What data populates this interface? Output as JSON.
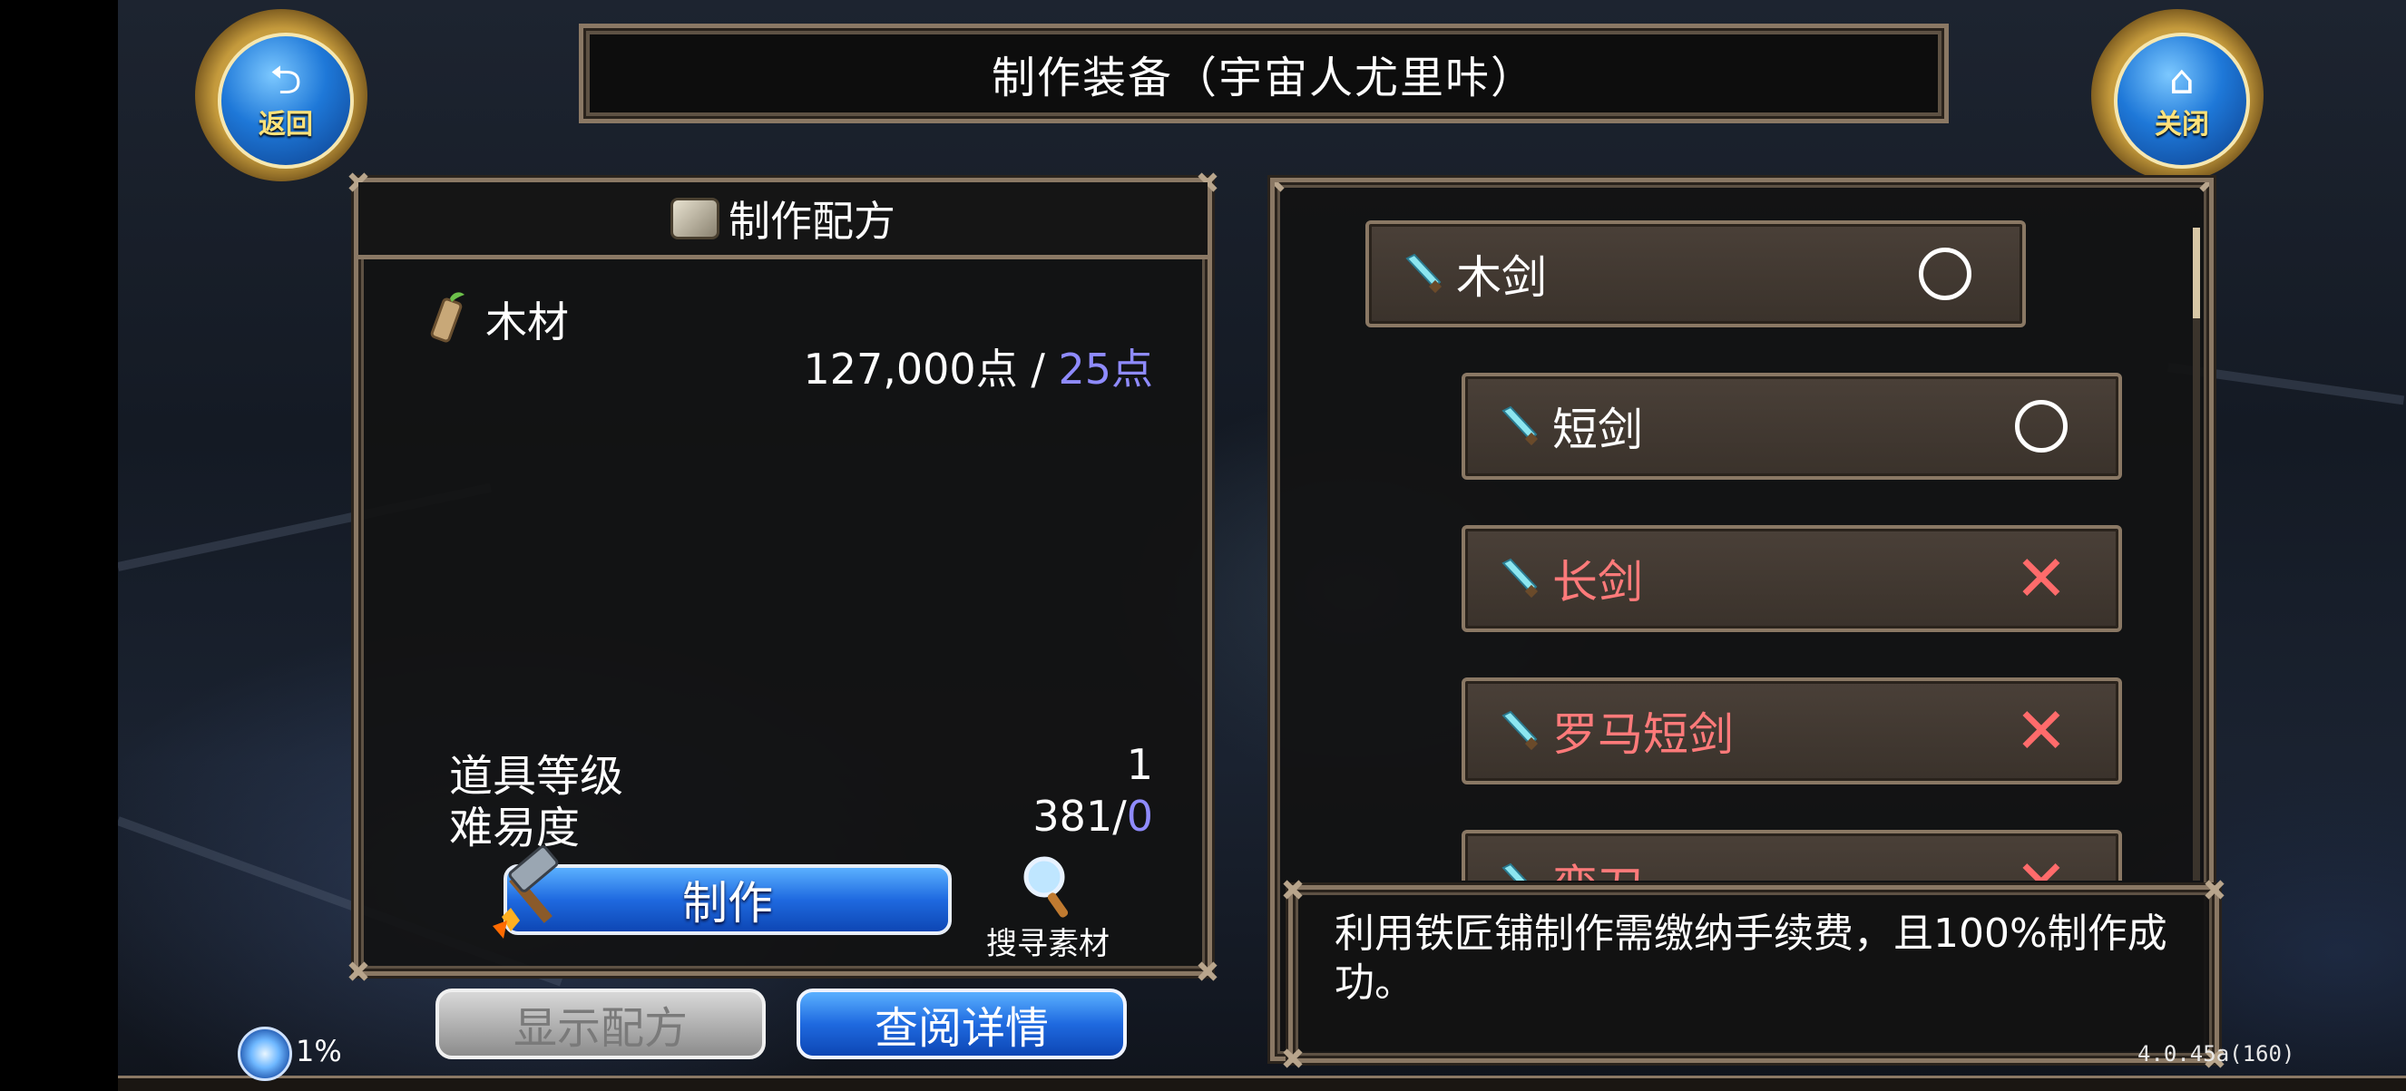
{
  "header": {
    "title": "制作装备（宇宙人尤里咔）"
  },
  "nav": {
    "back_label": "返回",
    "close_label": "关闭"
  },
  "recipe": {
    "panel_title": "制作配方",
    "material": {
      "name": "木材",
      "owned": "127,000点",
      "separator": " / ",
      "required": "25点"
    },
    "item_level_label": "道具等级",
    "item_level_value": "1",
    "difficulty_label": "难易度",
    "difficulty_value": "381/",
    "difficulty_extra": "0",
    "craft_button": "制作",
    "search_material_label": "搜寻素材"
  },
  "bottom_buttons": {
    "show_recipe": "显示配方",
    "view_details": "查阅详情"
  },
  "items": [
    {
      "name": "木剑",
      "status": "available",
      "craftable": true
    },
    {
      "name": "短剑",
      "status": "available",
      "craftable": true
    },
    {
      "name": "长剑",
      "status": "unavailable",
      "craftable": false
    },
    {
      "name": "罗马短剑",
      "status": "unavailable",
      "craftable": false
    },
    {
      "name": "弯刀",
      "status": "unavailable",
      "craftable": false
    }
  ],
  "description": "利用铁匠铺制作需缴纳手续费，且100%制作成功。",
  "status_bar": {
    "exp_percent": "1%",
    "version": "4.0.45a(160)"
  },
  "colors": {
    "accent_blue": "#1f6ae0",
    "frame_border": "#8a7864",
    "unavailable_red": "#ff7a7a",
    "highlight_blue": "#8f8bff"
  }
}
